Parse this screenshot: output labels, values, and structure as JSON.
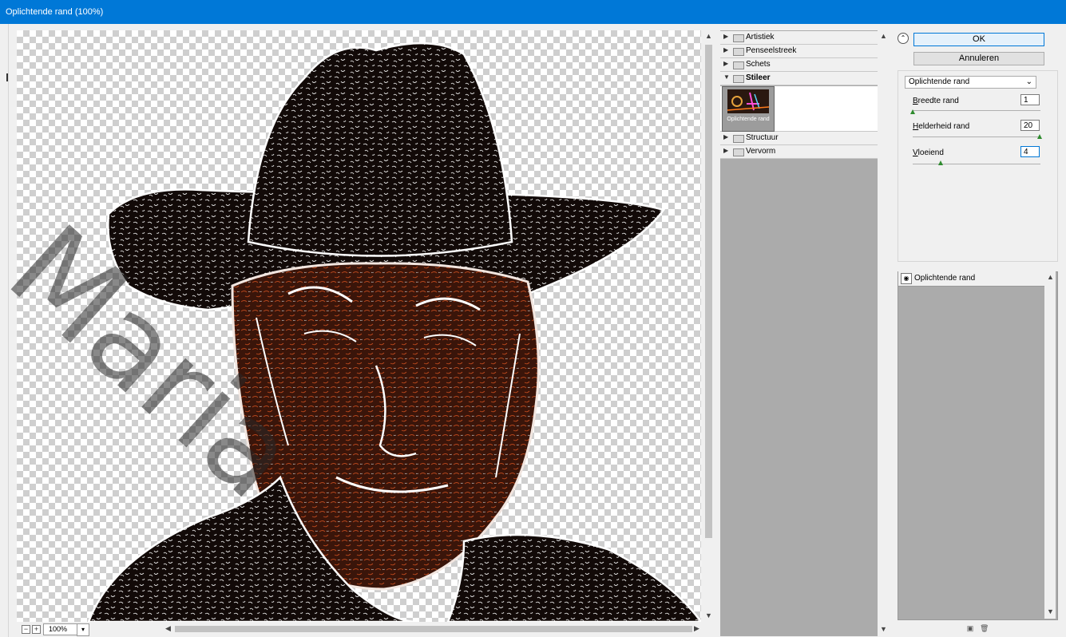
{
  "window": {
    "title": "Oplichtende rand (100%)"
  },
  "preview": {
    "zoom": "100%"
  },
  "gallery": {
    "categories": [
      {
        "label": "Artistiek",
        "open": false
      },
      {
        "label": "Penseelstreek",
        "open": false
      },
      {
        "label": "Schets",
        "open": false
      },
      {
        "label": "Stileer",
        "open": true
      },
      {
        "label": "Structuur",
        "open": false
      },
      {
        "label": "Vervorm",
        "open": false
      }
    ],
    "selected_thumb_label": "Oplichtende rand"
  },
  "buttons": {
    "ok": "OK",
    "cancel": "Annuleren"
  },
  "filter": {
    "selected": "Oplichtende rand",
    "params": [
      {
        "label": "Breedte rand",
        "mnemonic": "B",
        "rest": "reedte rand",
        "value": "1",
        "fraction": 0.0
      },
      {
        "label": "Helderheid rand",
        "mnemonic": "H",
        "rest": "elderheid rand",
        "value": "20",
        "fraction": 1.0
      },
      {
        "label": "Vloeiend",
        "mnemonic": "V",
        "rest": "loeiend",
        "value": "4",
        "fraction": 0.27
      }
    ]
  },
  "layers": {
    "items": [
      {
        "label": "Oplichtende rand"
      }
    ]
  },
  "watermark": "Maria"
}
